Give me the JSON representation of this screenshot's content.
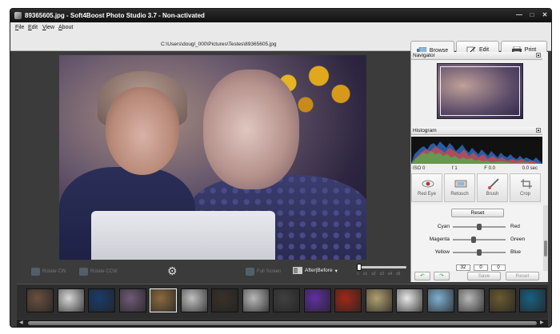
{
  "window": {
    "title": "89365605.jpg - Soft4Boost Photo Studio 3.7 - Non-activated"
  },
  "menu": [
    {
      "label": "File",
      "underline": "F",
      "rest": "ile"
    },
    {
      "label": "Edit",
      "underline": "E",
      "rest": "dit"
    },
    {
      "label": "View",
      "underline": "V",
      "rest": "iew"
    },
    {
      "label": "About",
      "underline": "A",
      "rest": "bout"
    }
  ],
  "file_path": "C:\\Users\\dougl_000\\Pictures\\Testes\\89365605.jpg",
  "tabs": {
    "browse": "Browse",
    "edit": "Edit",
    "print": "Print"
  },
  "viewer_toolbar": {
    "rotate_cw": "Rotate CW",
    "rotate_ccw": "Rotate CCW",
    "full_screen": "Full Screen",
    "after_before": "After|Before",
    "zoom_ticks": [
      "x1",
      "x2",
      "x3",
      "x4",
      "x5"
    ],
    "zoom_level": 0
  },
  "panel": {
    "navigator_title": "Navigator",
    "histogram_title": "Histogram",
    "histogram_info": {
      "iso": "ISO 0",
      "f": "f 1",
      "fstop": "F 0.0",
      "exposure": "0.0 sec"
    },
    "tools": [
      {
        "label": "Red Eye",
        "icon": "eye-icon"
      },
      {
        "label": "Retouch",
        "icon": "retouch-icon"
      },
      {
        "label": "Brush",
        "icon": "brush-icon"
      },
      {
        "label": "Crop",
        "icon": "crop-icon"
      }
    ],
    "reset_label": "Reset",
    "color_balance": [
      {
        "left": "Cyan",
        "right": "Red",
        "value": 0.0
      },
      {
        "left": "Magenta",
        "right": "Green",
        "value": -0.1
      },
      {
        "left": "Yellow",
        "right": "Blue",
        "value": 0.0
      }
    ],
    "values": [
      "32",
      "0",
      "0"
    ],
    "actions": {
      "save": "Save",
      "reset": "Reset"
    }
  },
  "filmstrip": {
    "count": 17,
    "selected_index": 4,
    "colors": [
      "#6a5040",
      "#d8d8d8",
      "#1a3c6a",
      "#705a78",
      "#8a6a40",
      "#c0c0c0",
      "#3a3028",
      "#b8b8b8",
      "#404040",
      "#6030a0",
      "#a02818",
      "#b0a070",
      "#e8e8e8",
      "#7fb0d0",
      "#b8b8b8",
      "#6a5a30",
      "#1a6080"
    ]
  }
}
